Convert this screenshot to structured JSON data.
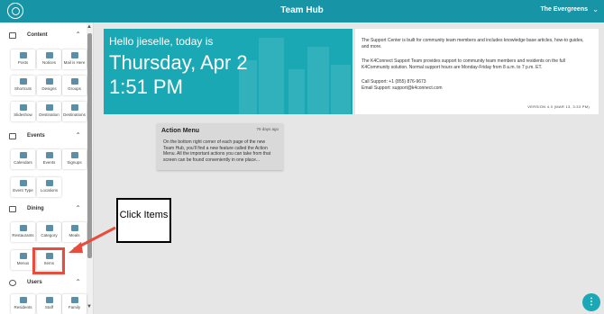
{
  "header": {
    "title": "Team Hub",
    "org": "The Evergreens"
  },
  "sidebar": {
    "sections": [
      {
        "label": "Content",
        "items": [
          "Posts",
          "Notices",
          "Mail is Here",
          "Shortcuts",
          "Designs",
          "Groups",
          "Slideshow",
          "Destination",
          "Destinations"
        ]
      },
      {
        "label": "Events",
        "items": [
          "Calendars",
          "Events",
          "Signups",
          "Event Type",
          "Locations"
        ]
      },
      {
        "label": "Dining",
        "items": [
          "Restaurants",
          "Category",
          "Meals",
          "Menus",
          "Items"
        ]
      },
      {
        "label": "Users",
        "items": [
          "Residents",
          "Staff",
          "Family"
        ]
      }
    ]
  },
  "hero": {
    "greeting": "Hello jieselle, today is",
    "date": "Thursday, Apr 2",
    "time": "1:51 PM"
  },
  "support": {
    "p1": "The Support Center is built for community team members and includes knowledge base articles, how-to guides, and more.",
    "p2": "The K4Connect Support Team provides support to community team members and residents on the full K4Community solution. Normal support hours are Monday-Friday from 8 a.m. to 7 p.m. ET.",
    "call": "Call Support: +1 (855) 876-9673",
    "email": "Email Support: support@k4connect.com",
    "version": "VERSION 4.0 (MAR 13, 3:33 PM)"
  },
  "action_menu": {
    "title": "Action Menu",
    "age": "76 days ago",
    "body": "On the bottom right corner of each page of the new Team Hub, you'll find a new feature called the Action Menu. All the important actions you can take from that screen can be found conveniently in one place..."
  },
  "callout": {
    "text": "Click Items"
  },
  "fab": {
    "symbol": "⋮"
  },
  "colors": {
    "teal": "#1795a6",
    "hero": "#1aa9b4",
    "highlight": "#e74c3c"
  }
}
